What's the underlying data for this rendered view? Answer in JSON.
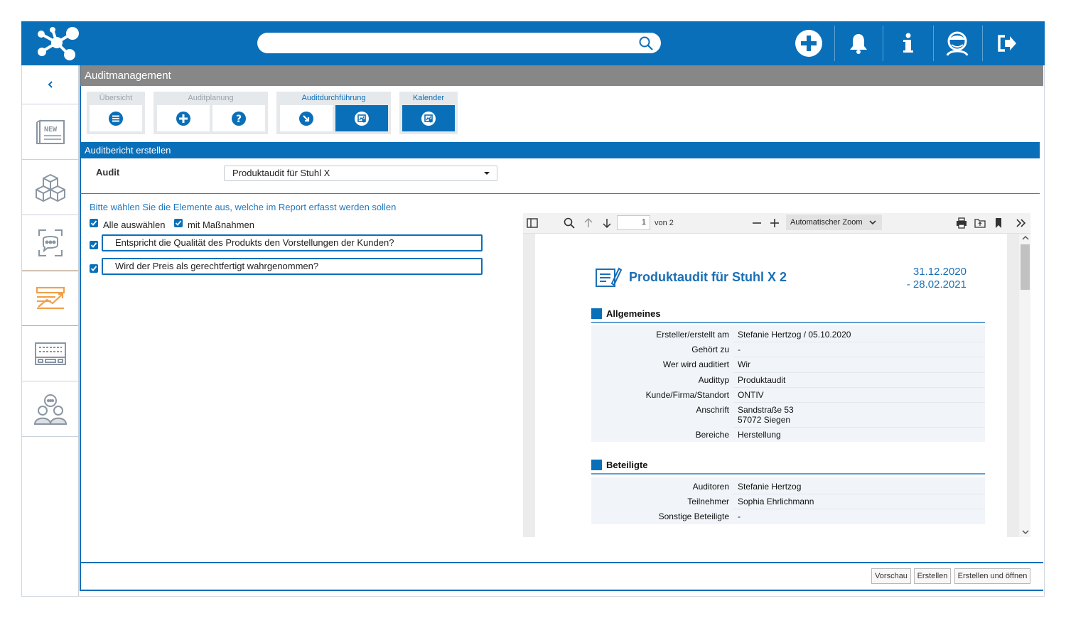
{
  "colors": {
    "brand": "#0a6fb9",
    "header_gray": "#878787",
    "link_blue": "#1f77bd"
  },
  "topbar": {
    "icons": [
      "add-circle-icon",
      "bell-icon",
      "info-icon",
      "user-avatar-icon",
      "logout-icon"
    ],
    "search": {
      "placeholder": ""
    }
  },
  "sidebar": {
    "collapse_icon": "chevron-left-icon",
    "items": [
      {
        "icon": "news-icon",
        "badge": "NEW"
      },
      {
        "icon": "cubes-icon"
      },
      {
        "icon": "chat-frame-icon"
      },
      {
        "icon": "chart-trend-icon"
      },
      {
        "icon": "keyboard-icon"
      },
      {
        "icon": "people-icon"
      }
    ]
  },
  "page": {
    "title": "Auditmanagement"
  },
  "tabs": [
    {
      "label": "Übersicht",
      "buttons": [
        "list-icon"
      ]
    },
    {
      "label": "Auditplanung",
      "buttons": [
        "add-icon",
        "help-icon"
      ]
    },
    {
      "label": "Auditdurchführung",
      "buttons": [
        "arrow-icon",
        "report-icon"
      ]
    },
    {
      "label": "Kalender",
      "buttons": [
        "calendar-report-icon"
      ]
    }
  ],
  "form": {
    "section_title": "Auditbericht erstellen",
    "audit_label": "Audit",
    "audit_value": "Produktaudit für Stuhl X",
    "instruction": "Bitte wählen Sie die Elemente aus, welche im Report erfasst werden sollen",
    "select_all": "Alle auswählen",
    "with_measures": "mit Maßnahmen",
    "questions": [
      "Entspricht die Qualität des Produkts den Vorstellungen der Kunden?",
      "Wird der Preis als gerechtfertigt wahrgenommen?"
    ]
  },
  "pdf": {
    "page_current": "1",
    "page_of": "von 2",
    "zoom": "Automatischer Zoom",
    "doc": {
      "title": "Produktaudit für Stuhl X 2",
      "date_start": "31.12.2020",
      "date_end": "- 28.02.2021",
      "section1": "Allgemeines",
      "section2": "Beteiligte",
      "general": [
        {
          "key": "Ersteller/erstellt am",
          "value": "Stefanie Hertzog / 05.10.2020"
        },
        {
          "key": "Gehört zu",
          "value": "-"
        },
        {
          "key": "Wer wird auditiert",
          "value": "Wir"
        },
        {
          "key": "Audittyp",
          "value": "Produktaudit"
        },
        {
          "key": "Kunde/Firma/Standort",
          "value": "ONTIV"
        },
        {
          "key": "Anschrift",
          "value": "Sandstraße 53",
          "value2": "57072 Siegen"
        },
        {
          "key": "Bereiche",
          "value": "Herstellung"
        }
      ],
      "participants": [
        {
          "key": "Auditoren",
          "value": "Stefanie Hertzog"
        },
        {
          "key": "Teilnehmer",
          "value": "Sophia Ehrlichmann"
        },
        {
          "key": "Sonstige Beteiligte",
          "value": "-"
        }
      ]
    }
  },
  "buttons": {
    "preview": "Vorschau",
    "create": "Erstellen",
    "create_open": "Erstellen und öffnen"
  }
}
